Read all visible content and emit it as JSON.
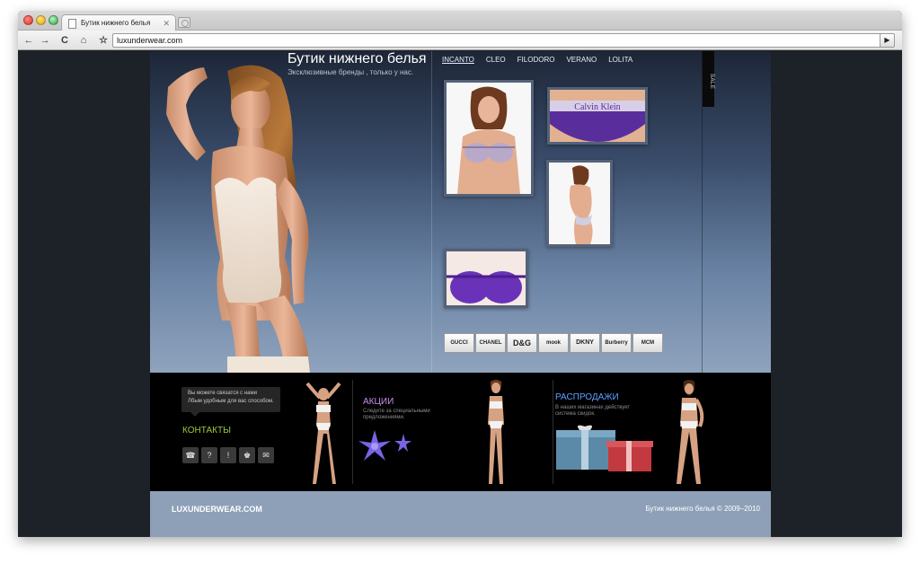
{
  "browser": {
    "tab_title": "Бутик нижнего белья",
    "url": "luxunderwear.com",
    "back_glyph": "←",
    "forward_glyph": "→",
    "reload_glyph": "C",
    "home_glyph": "⌂",
    "star_glyph": "☆",
    "close_glyph": "✕",
    "go_glyph": "▶"
  },
  "header": {
    "title": "Бутик нижнего белья",
    "subtitle": "Эксклюзивные бренды , только у нас."
  },
  "nav": {
    "items": [
      "INCANTO",
      "CLEO",
      "FILODORO",
      "VERANO",
      "LOLITA"
    ]
  },
  "sale_tab": "SALE",
  "thumbnails": [
    {
      "subject": "bra-front"
    },
    {
      "subject": "calvin-klein-brief",
      "print": "Calvin Klein"
    },
    {
      "subject": "model-back"
    },
    {
      "subject": "purple-bra"
    }
  ],
  "brand_logos": [
    "GUCCI",
    "CHANEL",
    "D&G",
    "mook",
    "DKNY",
    "Burberry",
    "MCM"
  ],
  "contacts": {
    "bubble_line1": "Вы можете связатся с нами",
    "bubble_line2": "Лбым удобным для вас способом.",
    "title": "КОНТАКТЫ",
    "icons": [
      "☎",
      "?",
      "!",
      "♚",
      "✉"
    ]
  },
  "promos": {
    "akcii_title": "АКЦИИ",
    "akcii_line1": "Следите за специальными",
    "akcii_line2": "предложениями.",
    "sales_title": "РАСПРОДАЖИ",
    "sales_line1": "В наших магазинах действует",
    "sales_line2": "система скидок."
  },
  "footer": {
    "logo": "LUXUNDERWEAR.COM",
    "copyright": "Бутик нижнего белья © 2009–2010"
  },
  "colors": {
    "contacts_accent": "#9ccc3a",
    "akcii_accent": "#c88ef0",
    "sales_accent": "#5ea0ff",
    "footer_bg": "#8ea0b7"
  }
}
